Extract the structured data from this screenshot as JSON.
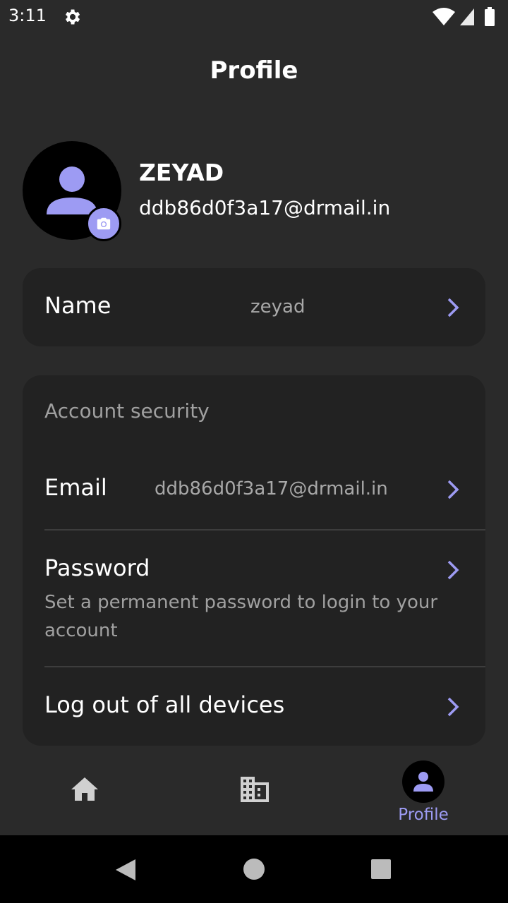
{
  "status_bar": {
    "time": "3:11",
    "icons": [
      "gear-icon",
      "wifi-icon",
      "signal-icon",
      "battery-icon"
    ]
  },
  "header": {
    "title": "Profile"
  },
  "profile": {
    "name": "ZEYAD",
    "email": "ddb86d0f3a17@drmail.in",
    "avatar_icon": "person-icon",
    "camera_icon": "camera-icon"
  },
  "name_card": {
    "label": "Name",
    "value": "zeyad"
  },
  "security": {
    "title": "Account security",
    "email": {
      "label": "Email",
      "value": "ddb86d0f3a17@drmail.in"
    },
    "password": {
      "label": "Password",
      "description": "Set a permanent password to login to your account"
    },
    "logout": {
      "label": "Log out of all devices"
    }
  },
  "bottom_nav": {
    "items": [
      {
        "icon": "home-icon",
        "label": ""
      },
      {
        "icon": "building-icon",
        "label": ""
      },
      {
        "icon": "person-icon",
        "label": "Profile",
        "active": true
      }
    ]
  },
  "colors": {
    "background": "#2a2a2a",
    "card": "#222222",
    "accent": "#9d9bf3",
    "muted_text": "#a0a0a0"
  }
}
